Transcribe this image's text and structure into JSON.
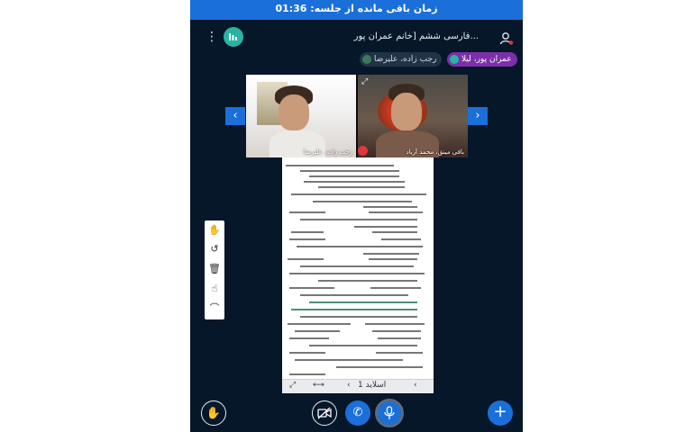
{
  "session": {
    "timer_text": "زمان باقی مانده از جلسه: 01:36"
  },
  "header": {
    "title": "فارسی ششم [خانم عمران پور..."
  },
  "participants": {
    "chips": [
      {
        "label": "عمران پور، لیلا"
      },
      {
        "label": "رجب زاده، علیرضا"
      }
    ]
  },
  "videos": {
    "tiles": [
      {
        "name": "رجب زاده، علیرضا"
      },
      {
        "name": "باقی مینق، محمد آرباد"
      }
    ]
  },
  "navigation": {
    "prev_glyph": "‹",
    "next_glyph": "›"
  },
  "document": {
    "slide_label": "اسلاید 1"
  },
  "toolbar": {
    "hand_glyph": "✋",
    "undo_glyph": "↺",
    "delete_glyph": "🗑",
    "pointer_glyph": "☝",
    "shape_glyph": "⌒"
  },
  "controls": {
    "raise_hand_glyph": "✋",
    "camera_glyph": "▭",
    "phone_glyph": "✆",
    "mic_glyph": "🎤",
    "add_glyph": "+"
  },
  "colors": {
    "accent": "#1b6fd9",
    "background": "#06172a",
    "presenter_chip": "#7c2fa8",
    "app_logo": "#2ab3a3"
  }
}
